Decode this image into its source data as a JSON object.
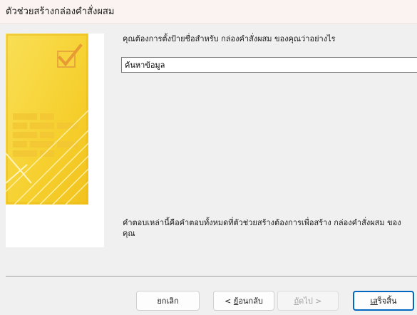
{
  "window": {
    "title": "ตัวช่วยสร้างกล่องคำสั่งผสม"
  },
  "main": {
    "prompt": "คุณต้องการตั้งป้ายชื่อสำหรับ กล่องคำสั่งผสม ของคุณว่าอย่างไร",
    "label_value": "ค้นหาข้อมูล",
    "explanation": "คำตอบเหล่านี้คือคำตอบทั้งหมดที่ตัวช่วยสร้างต้องการเพื่อสร้าง กล่องคำสั่งผสม ของคุณ"
  },
  "buttons": {
    "cancel": "ยกเลิก",
    "back_prefix": "< ",
    "back_key": "ย้",
    "back_rest": "อนกลับ",
    "next_key": "ถั",
    "next_rest": "ดไป >",
    "finish_key": "เส",
    "finish_rest": "ร็จสิ้น"
  },
  "colors": {
    "accent": "#0067c0",
    "art_yellow": "#f7d23a",
    "title_bar": "#fbf3f1"
  },
  "icons": [
    "wizard-illustration"
  ]
}
